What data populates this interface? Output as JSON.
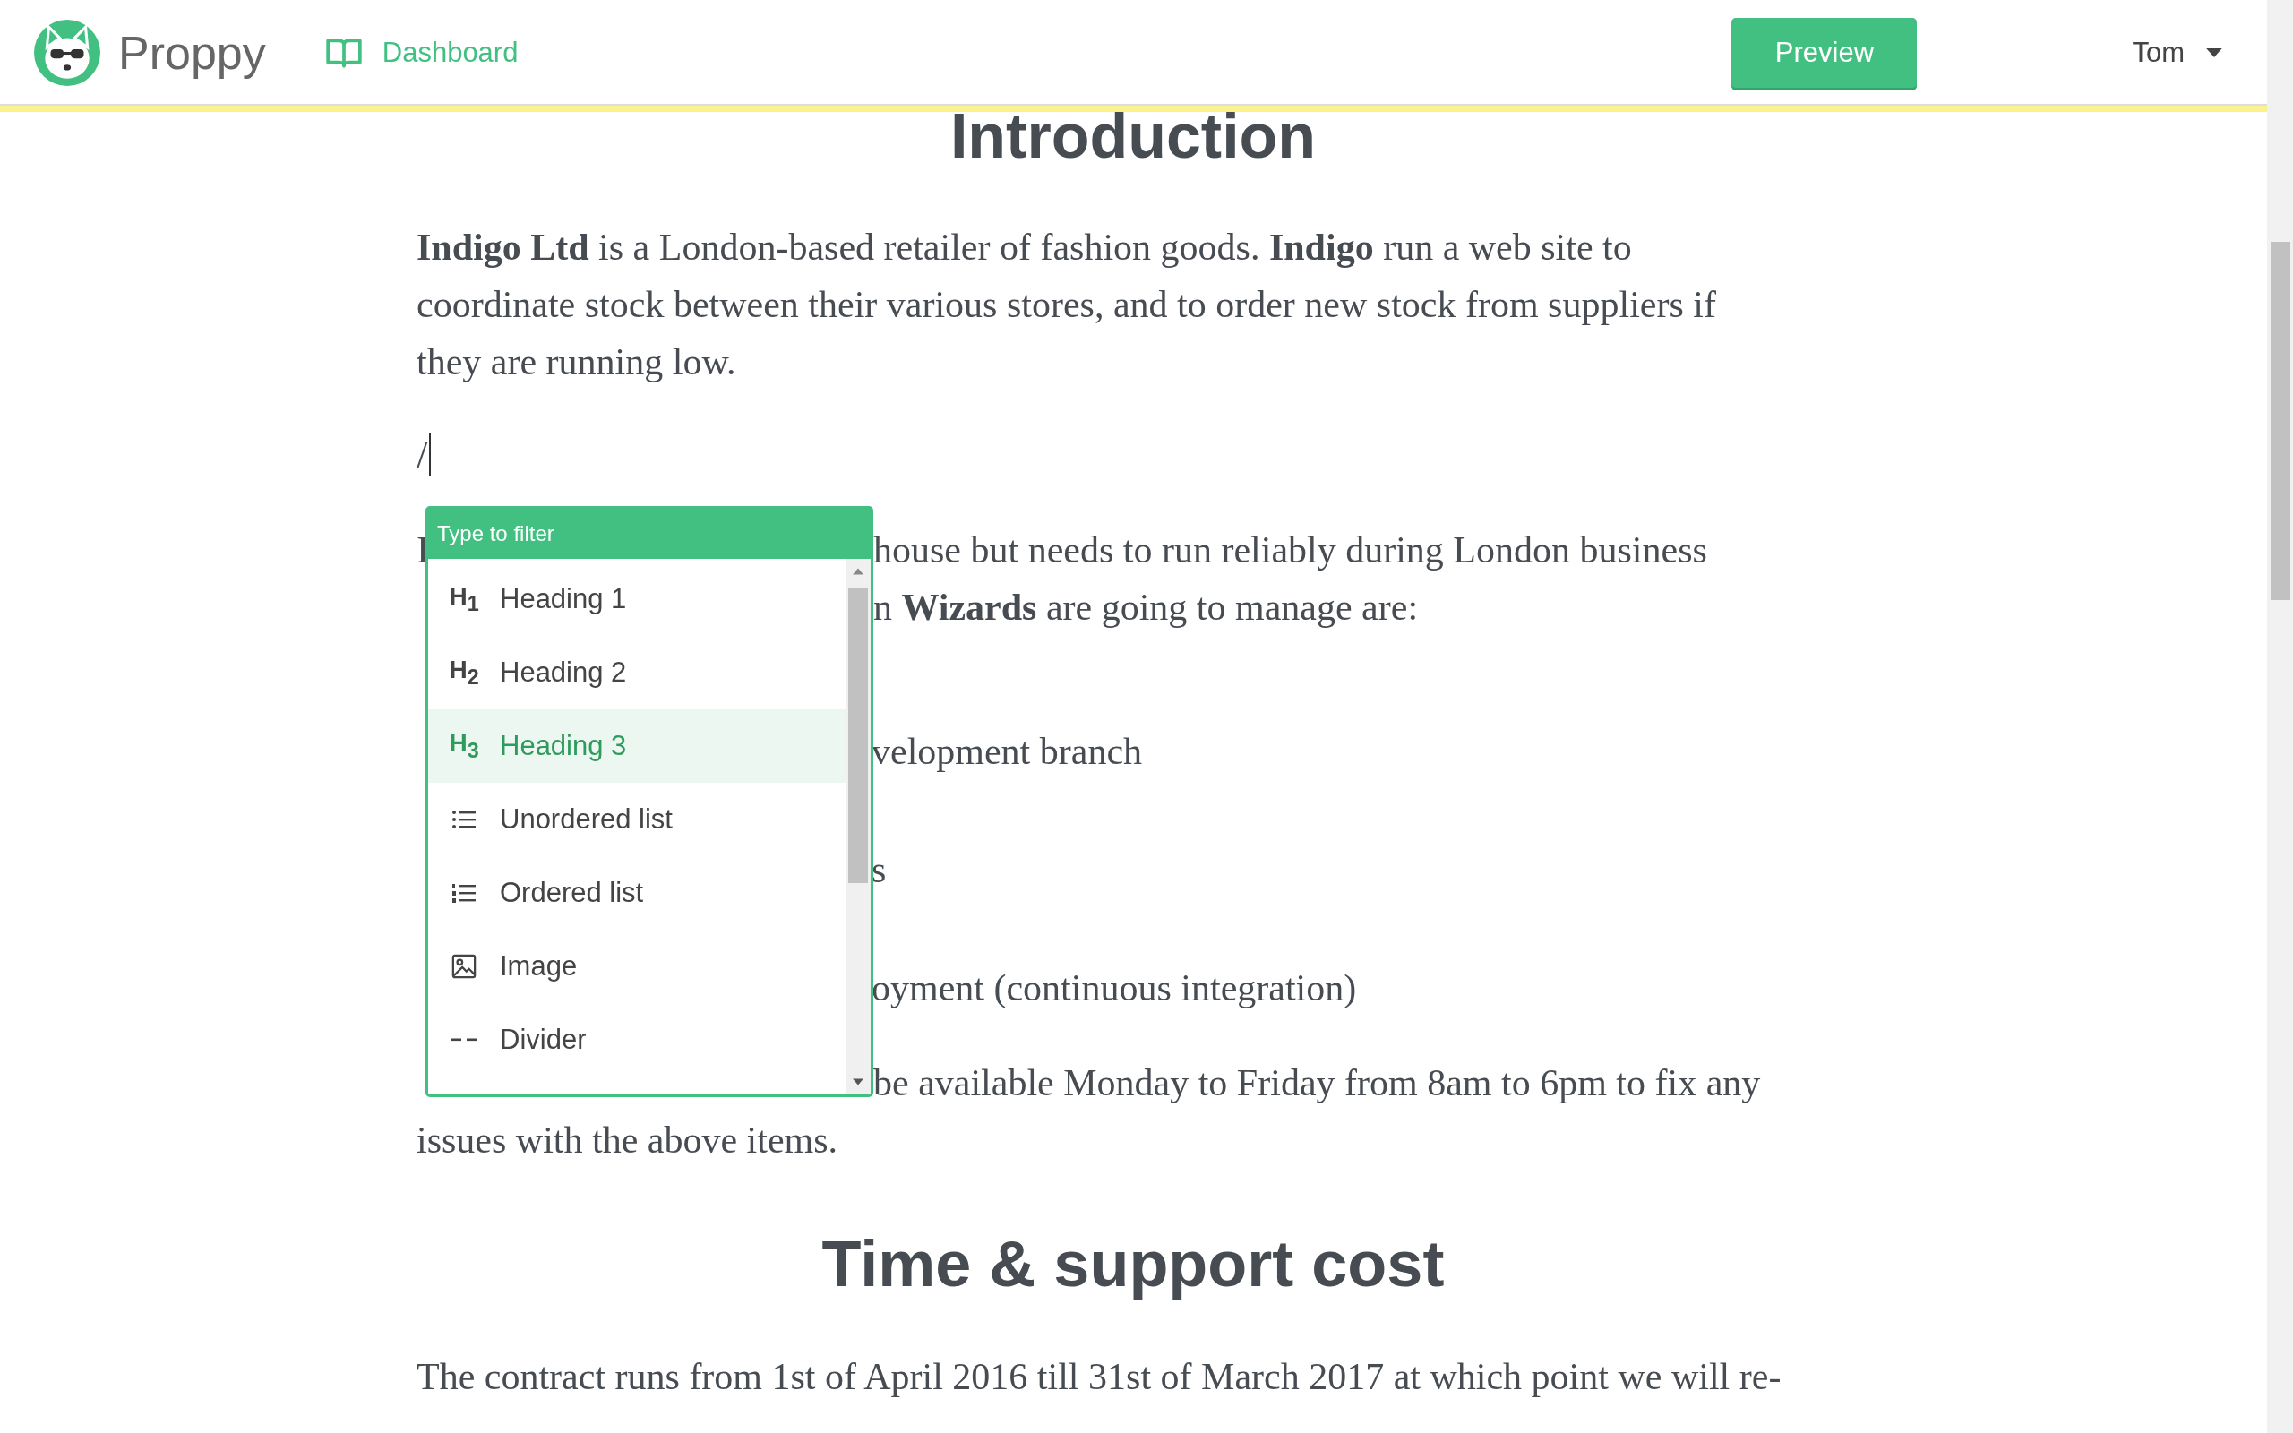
{
  "header": {
    "app_name": "Proppy",
    "nav_link": "Dashboard",
    "preview_button": "Preview",
    "user_menu": "Tom"
  },
  "document": [
    {
      "kind": "heading",
      "text": "Introduction"
    },
    {
      "kind": "paragraph",
      "lines": [
        "**Indigo Ltd** is a London-based retailer of fashion goods. **Indigo** run a web site to",
        "coordinate stock between their various stores, and to order new stock from suppliers if",
        "they are running low."
      ]
    },
    {
      "kind": "input",
      "text": "/"
    },
    {
      "kind": "split",
      "lines": [
        {
          "left": "I",
          "right": "house but needs to run reliably during London business"
        },
        {
          "right": "n **Wizards** are going to manage are:"
        }
      ]
    },
    {
      "kind": "list",
      "items": [
        "velopment branch",
        "s",
        "oyment (continuous integration)"
      ]
    },
    {
      "kind": "split",
      "lines": [
        {
          "right": "be available Monday to Friday from 8am to 6pm to fix any"
        },
        {
          "left": "issues with the above items."
        }
      ]
    },
    {
      "kind": "subheading",
      "text": "Time & support cost"
    },
    {
      "kind": "paragraph",
      "lines": [
        "The contract runs from 1st of  April 2016 till 31st of March 2017 at which point we will re-"
      ]
    }
  ],
  "slash_menu": {
    "placeholder": "Type to filter",
    "items": [
      {
        "kind": "heading",
        "icon": "H$_{1}$",
        "label": "Heading 1",
        "selected": false
      },
      {
        "kind": "heading",
        "icon": "H$_{2}$",
        "label": "Heading 2",
        "selected": false
      },
      {
        "kind": "heading",
        "icon": "H$_{3}$",
        "label": "Heading 3",
        "selected": true
      },
      {
        "kind": "unordered",
        "label": "Unordered list",
        "selected": false
      },
      {
        "kind": "ordered",
        "label": "Ordered list",
        "selected": false
      },
      {
        "kind": "image",
        "label": "Image",
        "selected": false
      },
      {
        "kind": "divider",
        "label": "Divider",
        "selected": false
      }
    ]
  }
}
